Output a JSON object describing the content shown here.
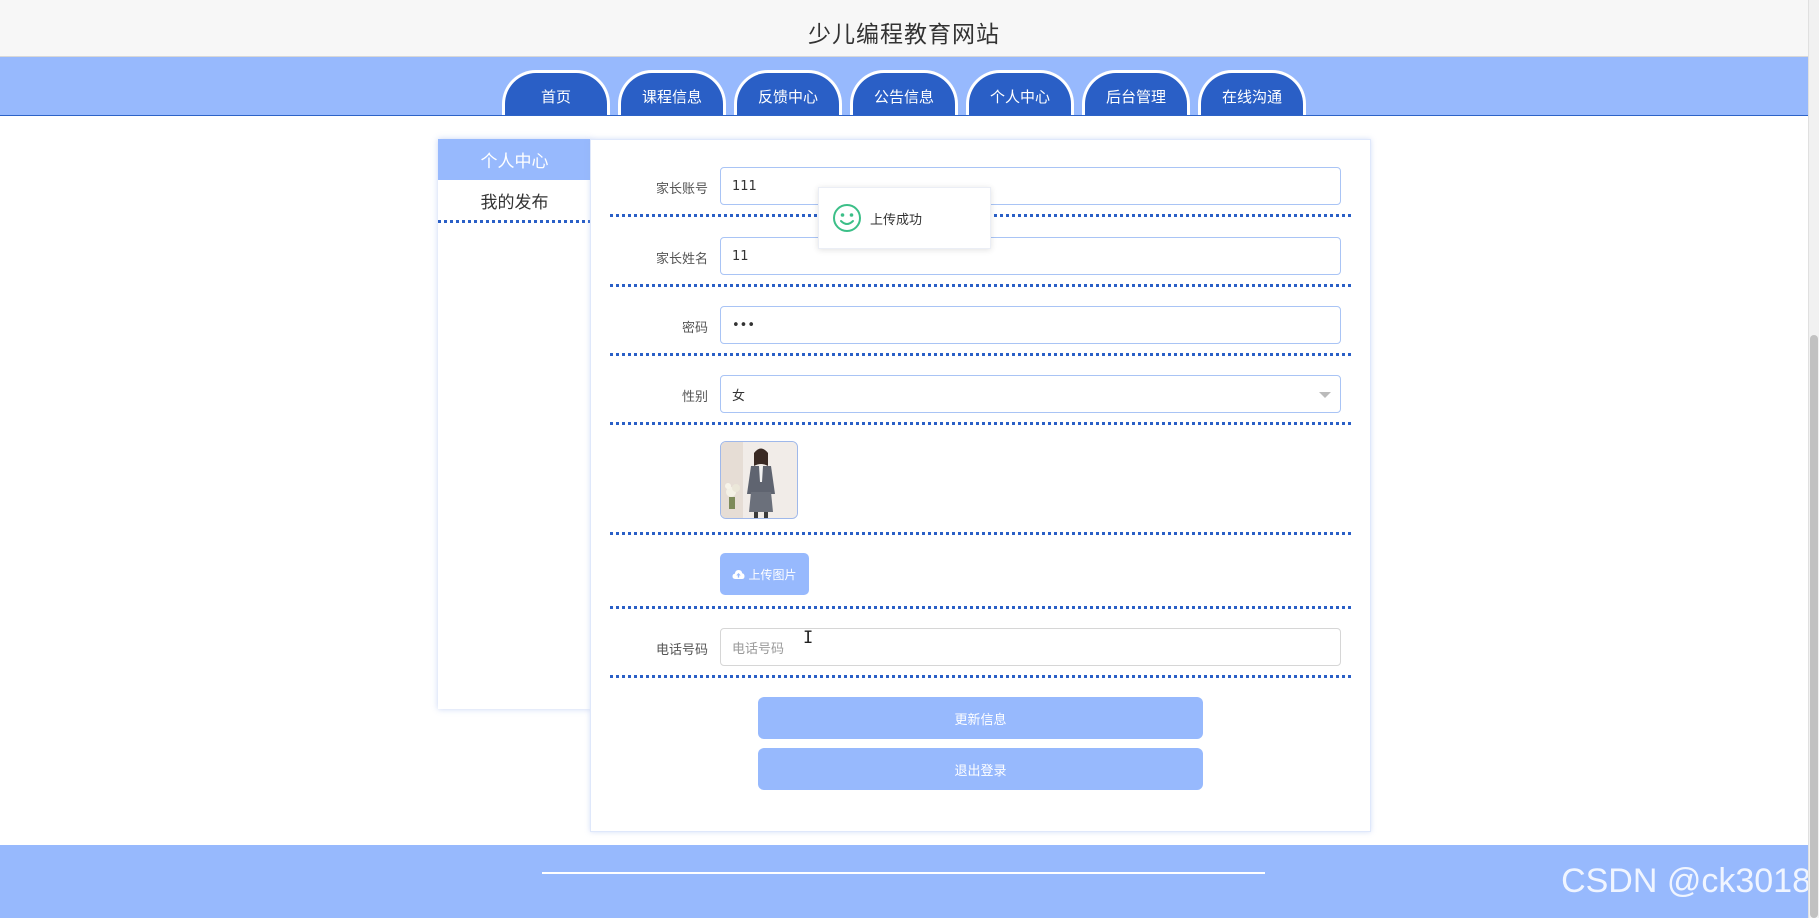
{
  "header": {
    "site_title": "少儿编程教育网站"
  },
  "nav": {
    "items": [
      {
        "label": "首页"
      },
      {
        "label": "课程信息"
      },
      {
        "label": "反馈中心"
      },
      {
        "label": "公告信息"
      },
      {
        "label": "个人中心"
      },
      {
        "label": "后台管理"
      },
      {
        "label": "在线沟通"
      }
    ]
  },
  "sidebar": {
    "title": "个人中心",
    "items": [
      {
        "label": "我的发布"
      }
    ]
  },
  "form": {
    "account": {
      "label": "家长账号",
      "value": "111"
    },
    "name": {
      "label": "家长姓名",
      "value": "11"
    },
    "password": {
      "label": "密码",
      "value": "•••"
    },
    "gender": {
      "label": "性别",
      "value": "女"
    },
    "upload_button": "上传图片",
    "phone": {
      "label": "电话号码",
      "placeholder": "电话号码"
    },
    "update_button": "更新信息",
    "logout_button": "退出登录"
  },
  "toast": {
    "message": "上传成功"
  },
  "watermark": "CSDN @ck3018",
  "colors": {
    "nav_bg": "#97b9fd",
    "nav_tab": "#2a5fc6",
    "button": "#97b9fd",
    "divider": "#2a5fc6",
    "toast_icon": "#3cbf88"
  }
}
